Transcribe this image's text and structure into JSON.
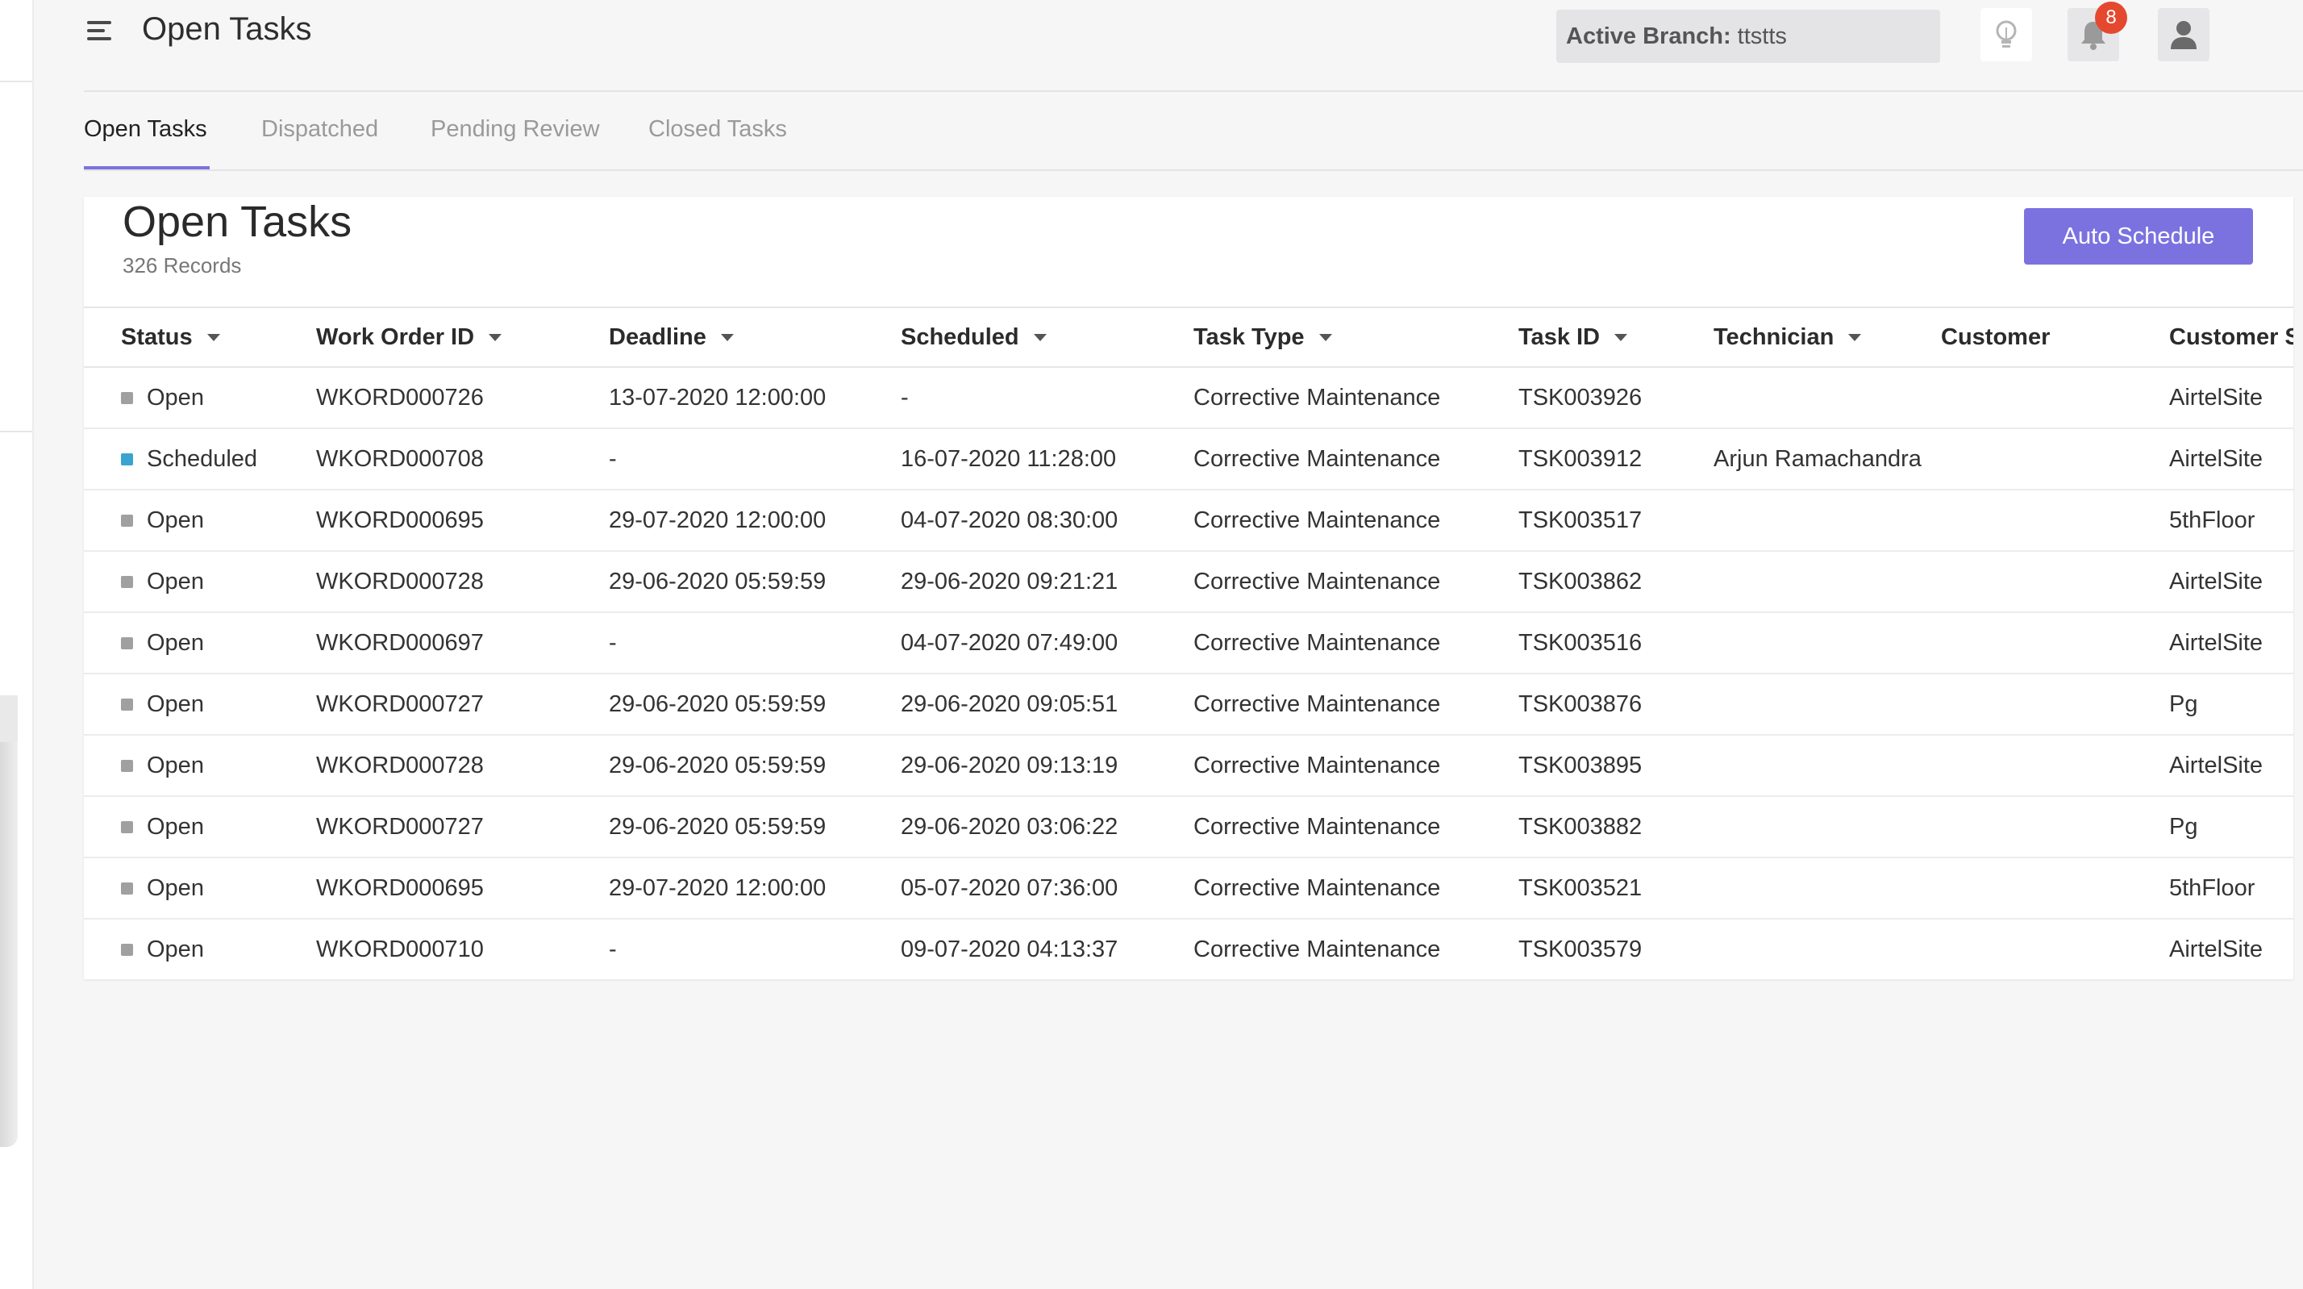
{
  "header": {
    "title": "Open Tasks",
    "branch_label": "Active Branch:",
    "branch_value": "ttstts",
    "notification_count": "8"
  },
  "tabs": [
    {
      "label": "Open Tasks",
      "active": true
    },
    {
      "label": "Dispatched",
      "active": false
    },
    {
      "label": "Pending Review",
      "active": false
    },
    {
      "label": "Closed Tasks",
      "active": false
    }
  ],
  "card": {
    "title": "Open Tasks",
    "records": "326 Records",
    "auto_schedule_label": "Auto Schedule"
  },
  "columns": [
    {
      "label": "Status",
      "sortable": true
    },
    {
      "label": "Work Order ID",
      "sortable": true
    },
    {
      "label": "Deadline",
      "sortable": true
    },
    {
      "label": "Scheduled",
      "sortable": true
    },
    {
      "label": "Task Type",
      "sortable": true
    },
    {
      "label": "Task ID",
      "sortable": true
    },
    {
      "label": "Technician",
      "sortable": true
    },
    {
      "label": "Customer",
      "sortable": false
    },
    {
      "label": "Customer S",
      "sortable": false
    }
  ],
  "colors": {
    "accent": "#7b72e0",
    "status_open": "#a0a0a0",
    "status_scheduled": "#3aa3d0",
    "badge": "#e4492f"
  },
  "rows": [
    {
      "status": "Open",
      "work_order": "WKORD000726",
      "deadline": "13-07-2020 12:00:00",
      "scheduled": "-",
      "task_type": "Corrective Maintenance",
      "task_id": "TSK003926",
      "technician": "",
      "customer": "",
      "customer_site": "AirtelSite"
    },
    {
      "status": "Scheduled",
      "work_order": "WKORD000708",
      "deadline": "-",
      "scheduled": "16-07-2020 11:28:00",
      "task_type": "Corrective Maintenance",
      "task_id": "TSK003912",
      "technician": "Arjun Ramachandra",
      "customer": "",
      "customer_site": "AirtelSite"
    },
    {
      "status": "Open",
      "work_order": "WKORD000695",
      "deadline": "29-07-2020 12:00:00",
      "scheduled": "04-07-2020 08:30:00",
      "task_type": "Corrective Maintenance",
      "task_id": "TSK003517",
      "technician": "",
      "customer": "",
      "customer_site": "5thFloor"
    },
    {
      "status": "Open",
      "work_order": "WKORD000728",
      "deadline": "29-06-2020 05:59:59",
      "scheduled": "29-06-2020 09:21:21",
      "task_type": "Corrective Maintenance",
      "task_id": "TSK003862",
      "technician": "",
      "customer": "",
      "customer_site": "AirtelSite"
    },
    {
      "status": "Open",
      "work_order": "WKORD000697",
      "deadline": "-",
      "scheduled": "04-07-2020 07:49:00",
      "task_type": "Corrective Maintenance",
      "task_id": "TSK003516",
      "technician": "",
      "customer": "",
      "customer_site": "AirtelSite"
    },
    {
      "status": "Open",
      "work_order": "WKORD000727",
      "deadline": "29-06-2020 05:59:59",
      "scheduled": "29-06-2020 09:05:51",
      "task_type": "Corrective Maintenance",
      "task_id": "TSK003876",
      "technician": "",
      "customer": "",
      "customer_site": "Pg"
    },
    {
      "status": "Open",
      "work_order": "WKORD000728",
      "deadline": "29-06-2020 05:59:59",
      "scheduled": "29-06-2020 09:13:19",
      "task_type": "Corrective Maintenance",
      "task_id": "TSK003895",
      "technician": "",
      "customer": "",
      "customer_site": "AirtelSite"
    },
    {
      "status": "Open",
      "work_order": "WKORD000727",
      "deadline": "29-06-2020 05:59:59",
      "scheduled": "29-06-2020 03:06:22",
      "task_type": "Corrective Maintenance",
      "task_id": "TSK003882",
      "technician": "",
      "customer": "",
      "customer_site": "Pg"
    },
    {
      "status": "Open",
      "work_order": "WKORD000695",
      "deadline": "29-07-2020 12:00:00",
      "scheduled": "05-07-2020 07:36:00",
      "task_type": "Corrective Maintenance",
      "task_id": "TSK003521",
      "technician": "",
      "customer": "",
      "customer_site": "5thFloor"
    },
    {
      "status": "Open",
      "work_order": "WKORD000710",
      "deadline": "-",
      "scheduled": "09-07-2020 04:13:37",
      "task_type": "Corrective Maintenance",
      "task_id": "TSK003579",
      "technician": "",
      "customer": "",
      "customer_site": "AirtelSite"
    }
  ]
}
